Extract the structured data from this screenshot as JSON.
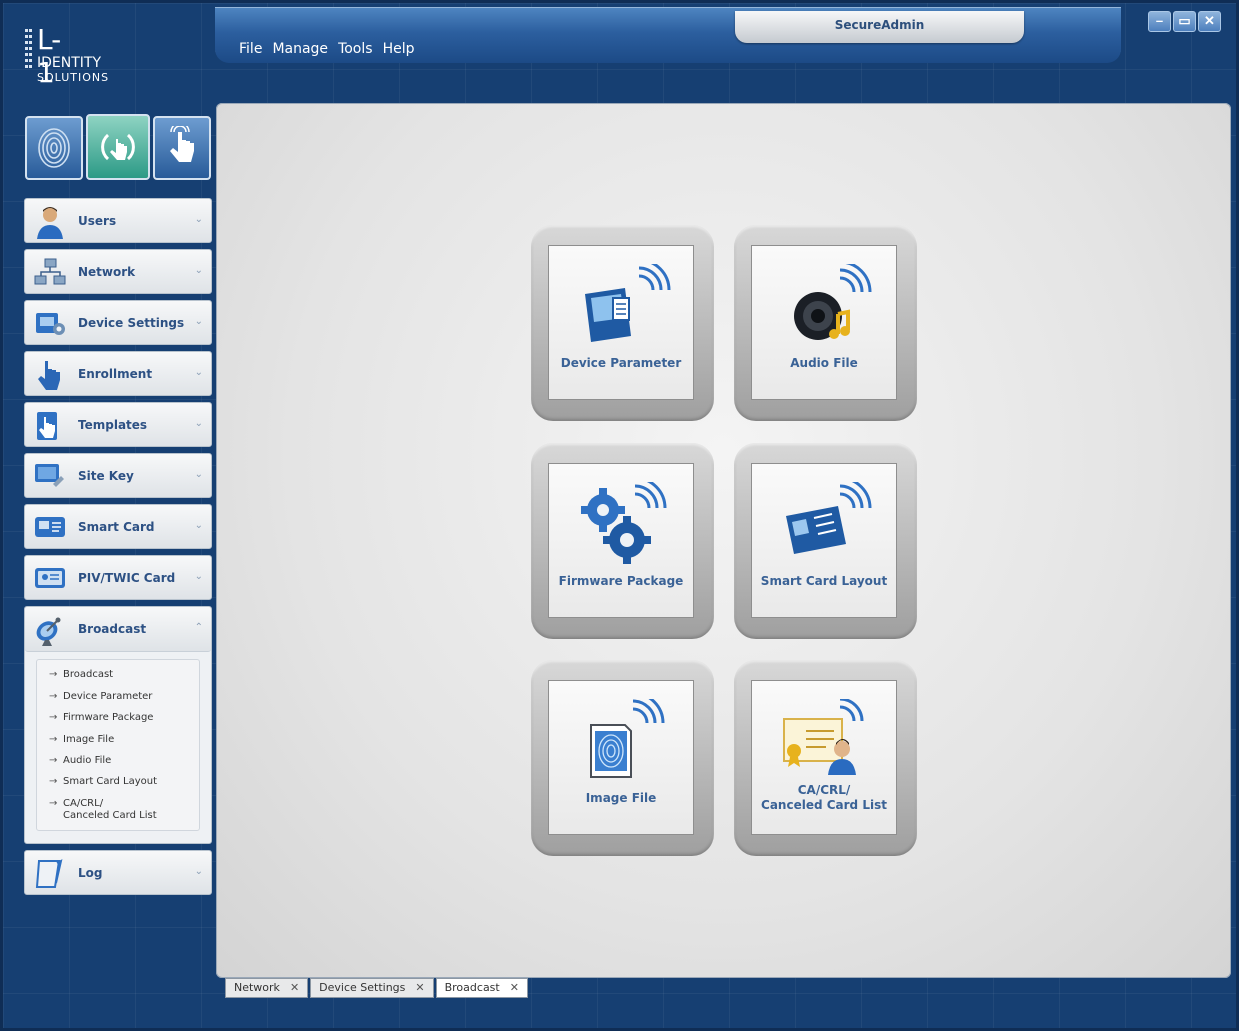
{
  "window": {
    "title": "SecureAdmin",
    "controls": [
      "–",
      "▭",
      "✕"
    ]
  },
  "menu": [
    "File",
    "Manage",
    "Tools",
    "Help"
  ],
  "logo": {
    "mark": "L-1",
    "line1": "IDENTITY",
    "line2": "SOLUTIONS"
  },
  "sidebar": {
    "items": [
      {
        "label": "Users",
        "icon": "user-icon"
      },
      {
        "label": "Network",
        "icon": "network-icon"
      },
      {
        "label": "Device Settings",
        "icon": "device-settings-icon"
      },
      {
        "label": "Enrollment",
        "icon": "hand-pointer-icon"
      },
      {
        "label": "Templates",
        "icon": "templates-icon"
      },
      {
        "label": "Site Key",
        "icon": "site-key-icon"
      },
      {
        "label": "Smart Card",
        "icon": "smart-card-icon"
      },
      {
        "label": "PIV/TWIC Card",
        "icon": "id-card-icon"
      }
    ],
    "broadcast": {
      "label": "Broadcast",
      "icon": "satellite-dish-icon",
      "sub_items": [
        "Broadcast",
        "Device Parameter",
        "Firmware Package",
        "Image File",
        "Audio File",
        "Smart Card Layout",
        "CA/CRL/\nCanceled Card List"
      ]
    },
    "log": {
      "label": "Log",
      "icon": "log-icon"
    }
  },
  "tiles": [
    {
      "label": "Device Parameter",
      "icon": "device-parameter-icon"
    },
    {
      "label": "Audio File",
      "icon": "speaker-icon"
    },
    {
      "label": "Firmware Package",
      "icon": "gears-icon"
    },
    {
      "label": "Smart Card Layout",
      "icon": "smart-card-layout-icon"
    },
    {
      "label": "Image File",
      "icon": "fingerprint-image-icon"
    },
    {
      "label": "CA/CRL/\nCanceled Card List",
      "icon": "certificate-user-icon"
    }
  ],
  "bottom_tabs": [
    {
      "label": "Network",
      "active": false
    },
    {
      "label": "Device Settings",
      "active": false
    },
    {
      "label": "Broadcast",
      "active": true
    }
  ],
  "close_glyph": "✕",
  "submenu_arrow": "→"
}
